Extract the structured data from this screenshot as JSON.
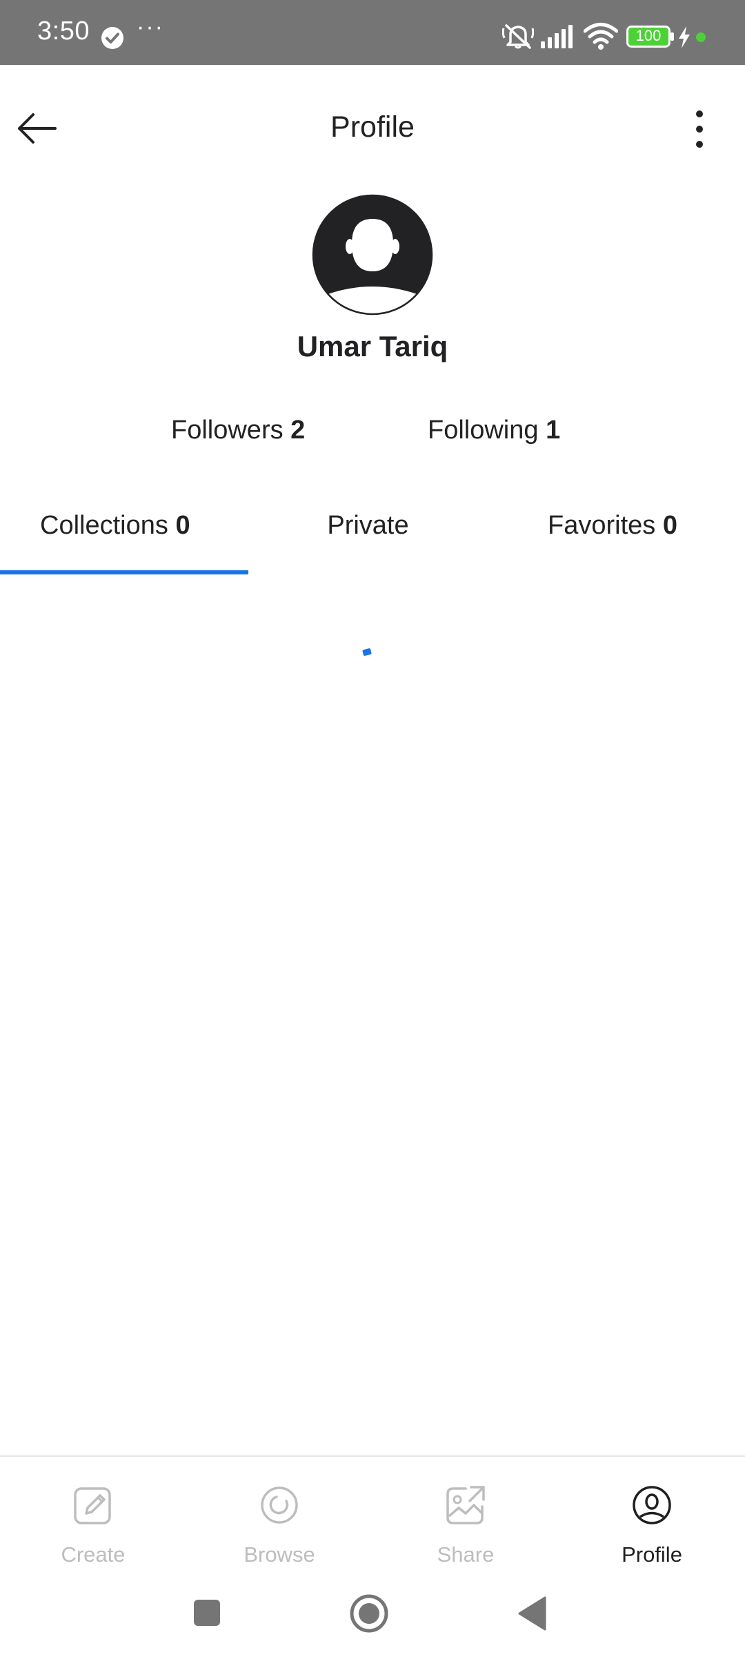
{
  "status_bar": {
    "time": "3:50",
    "more": "···",
    "battery": "100",
    "icons": [
      "check-circle-icon",
      "mute-icon",
      "signal-icon",
      "wifi-icon",
      "battery-icon",
      "charging-icon"
    ]
  },
  "header": {
    "title": "Profile"
  },
  "profile": {
    "name": "Umar Tariq",
    "followers_label": "Followers",
    "followers_count": "2",
    "following_label": "Following",
    "following_count": "1"
  },
  "tabs": [
    {
      "label": "Collections",
      "count": "0",
      "active": true
    },
    {
      "label": "Private",
      "count": "",
      "active": false
    },
    {
      "label": "Favorites",
      "count": "0",
      "active": false
    }
  ],
  "bottom_nav": [
    {
      "label": "Create",
      "icon": "create-icon",
      "active": false
    },
    {
      "label": "Browse",
      "icon": "browse-icon",
      "active": false
    },
    {
      "label": "Share",
      "icon": "share-icon",
      "active": false
    },
    {
      "label": "Profile",
      "icon": "profile-icon",
      "active": true
    }
  ],
  "colors": {
    "accent": "#1a73e8",
    "status_bar": "#757575",
    "inactive": "#bdbdbd",
    "battery": "#4cd137"
  }
}
